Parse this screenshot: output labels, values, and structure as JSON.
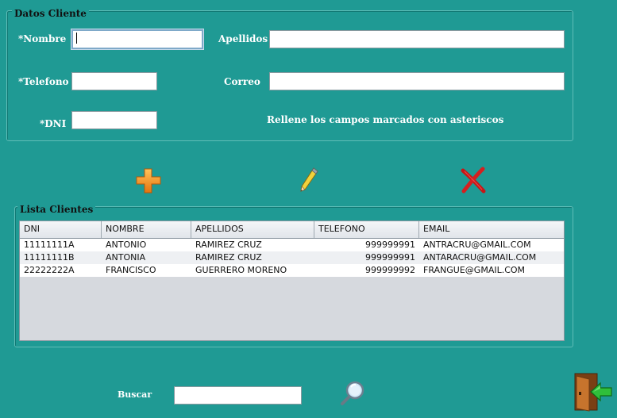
{
  "client_panel": {
    "title": "Datos Cliente",
    "labels": {
      "nombre": "*Nombre",
      "apellidos": "Apellidos",
      "telefono": "*Telefono",
      "correo": "Correo",
      "dni": "*DNI"
    },
    "values": {
      "nombre": "",
      "apellidos": "",
      "telefono": "",
      "correo": "",
      "dni": ""
    },
    "hint": "Rellene los campos marcados con asteriscos"
  },
  "toolbar": {
    "add_icon": "plus-icon",
    "edit_icon": "pencil-icon",
    "delete_icon": "x-icon",
    "colors": {
      "add": "#f28a1c",
      "delete": "#d21c1c"
    }
  },
  "list_panel": {
    "title": "Lista Clientes",
    "columns": [
      "DNI",
      "NOMBRE",
      "APELLIDOS",
      "TELEFONO",
      "EMAIL"
    ],
    "rows": [
      [
        "11111111A",
        "ANTONIO",
        "RAMIREZ CRUZ",
        "999999991",
        "ANTRACRU@GMAIL.COM"
      ],
      [
        "11111111B",
        "ANTONIA",
        "RAMIREZ CRUZ",
        "999999991",
        "ANTARACRU@GMAIL.COM"
      ],
      [
        "22222222A",
        "FRANCISCO",
        "GUERRERO MORENO",
        "999999992",
        "FRANGUE@GMAIL.COM"
      ]
    ]
  },
  "search": {
    "label": "Buscar",
    "value": "",
    "icon": "magnifier-icon"
  },
  "exit": {
    "icon": "exit-door-icon"
  },
  "theme": {
    "background": "#1f9a94"
  }
}
